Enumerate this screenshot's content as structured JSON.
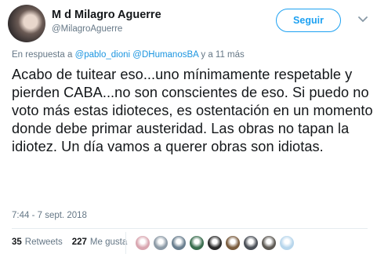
{
  "author": {
    "display_name": "M d Milagro Aguerre",
    "handle": "@MilagroAguerre"
  },
  "follow_button": {
    "label": "Seguir"
  },
  "reply_context": {
    "prefix": "En respuesta a",
    "mention_1": "@pablo_dioni",
    "mention_2": "@DHumanosBA",
    "suffix": "y a 11 más"
  },
  "tweet": {
    "text": "Acabo de tuitear eso...uno mínimamente respetable y pierden CABA...no son conscientes de eso. Si puedo no voto más estas idioteces, es ostentación en un momento donde debe primar austeridad. Las obras no tapan la idiotez. Un día vamos a querer obras son idiotas.",
    "timestamp": "7:44 - 7 sept. 2018"
  },
  "stats": {
    "retweets_count": "35",
    "retweets_label": "Retweets",
    "likes_count": "227",
    "likes_label": "Me gusta"
  },
  "likers": [
    {
      "name": "liker-1",
      "color": "#d9a6b0"
    },
    {
      "name": "liker-2",
      "color": "#8c9aa6"
    },
    {
      "name": "liker-3",
      "color": "#6a7f8f"
    },
    {
      "name": "liker-4",
      "color": "#3a6e4f"
    },
    {
      "name": "liker-5",
      "color": "#2b2b2b"
    },
    {
      "name": "liker-6",
      "color": "#7a5c3e"
    },
    {
      "name": "liker-7",
      "color": "#4a4f57"
    },
    {
      "name": "liker-8",
      "color": "#5e5a54"
    },
    {
      "name": "liker-9",
      "color": "#b7d6ec"
    }
  ],
  "colors": {
    "accent": "#1da1f2",
    "mention": "#1b95e0",
    "secondary_text": "#657786"
  }
}
